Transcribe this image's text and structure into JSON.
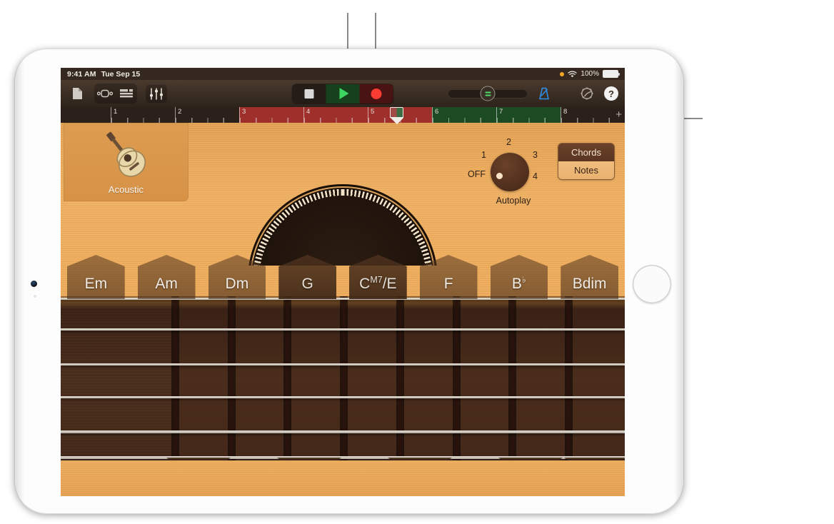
{
  "statusbar": {
    "time": "9:41 AM",
    "date": "Tue Sep 15",
    "battery_percent": "100%",
    "icons": [
      "record-dot",
      "wifi-icon",
      "battery-icon"
    ]
  },
  "toolbar": {
    "left_buttons": [
      {
        "name": "my-songs-button",
        "icon": "document-icon"
      },
      {
        "name": "loop-browser-button",
        "icon": "instrument-icon"
      },
      {
        "name": "track-view-button",
        "icon": "tracks-icon"
      },
      {
        "name": "mixer-button",
        "icon": "mixer-sliders-icon"
      }
    ],
    "transport": [
      {
        "name": "stop-button",
        "icon": "stop-square-icon",
        "color": "#d9d9d9"
      },
      {
        "name": "play-button",
        "icon": "play-triangle-icon",
        "color": "#3fd362"
      },
      {
        "name": "record-button",
        "icon": "record-circle-icon",
        "color": "#fa3c32"
      }
    ],
    "master_slider_name": "master-volume-slider",
    "metronome_name": "metronome-button",
    "metronome_color": "#2f8fe8",
    "settings_name": "settings-button",
    "help_label": "?"
  },
  "ruler": {
    "bars": [
      {
        "number": "1",
        "style": "dark"
      },
      {
        "number": "2",
        "style": "dark"
      },
      {
        "number": "3",
        "style": "red"
      },
      {
        "number": "4",
        "style": "red"
      },
      {
        "number": "5",
        "style": "red"
      },
      {
        "number": "6",
        "style": "green"
      },
      {
        "number": "7",
        "style": "green"
      },
      {
        "number": "8",
        "style": "dark"
      }
    ],
    "add_track_label": "+",
    "playhead_name": "playhead-marker"
  },
  "instrument": {
    "label": "Acoustic",
    "icon": "acoustic-guitar-icon"
  },
  "autoplay": {
    "title": "Autoplay",
    "positions": {
      "off": "OFF",
      "one": "1",
      "two": "2",
      "three": "3",
      "four": "4"
    },
    "selected": "OFF"
  },
  "mode_toggle": {
    "chords_label": "Chords",
    "notes_label": "Notes",
    "selected": "Chords"
  },
  "chords": [
    {
      "root": "Em",
      "sup": ""
    },
    {
      "root": "Am",
      "sup": ""
    },
    {
      "root": "Dm",
      "sup": ""
    },
    {
      "root": "G",
      "sup": ""
    },
    {
      "root": "C",
      "sup": "M7",
      "tail": "/E"
    },
    {
      "root": "F",
      "sup": ""
    },
    {
      "root": "B",
      "sup": "♭"
    },
    {
      "root": "Bdim",
      "sup": ""
    }
  ],
  "colors": {
    "wood_light": "#f0ad5a",
    "wood_dark": "#442819",
    "cycle_green": "#1c4a23",
    "region_red": "#9e2f2b",
    "toolbar": "#3a2d23"
  }
}
